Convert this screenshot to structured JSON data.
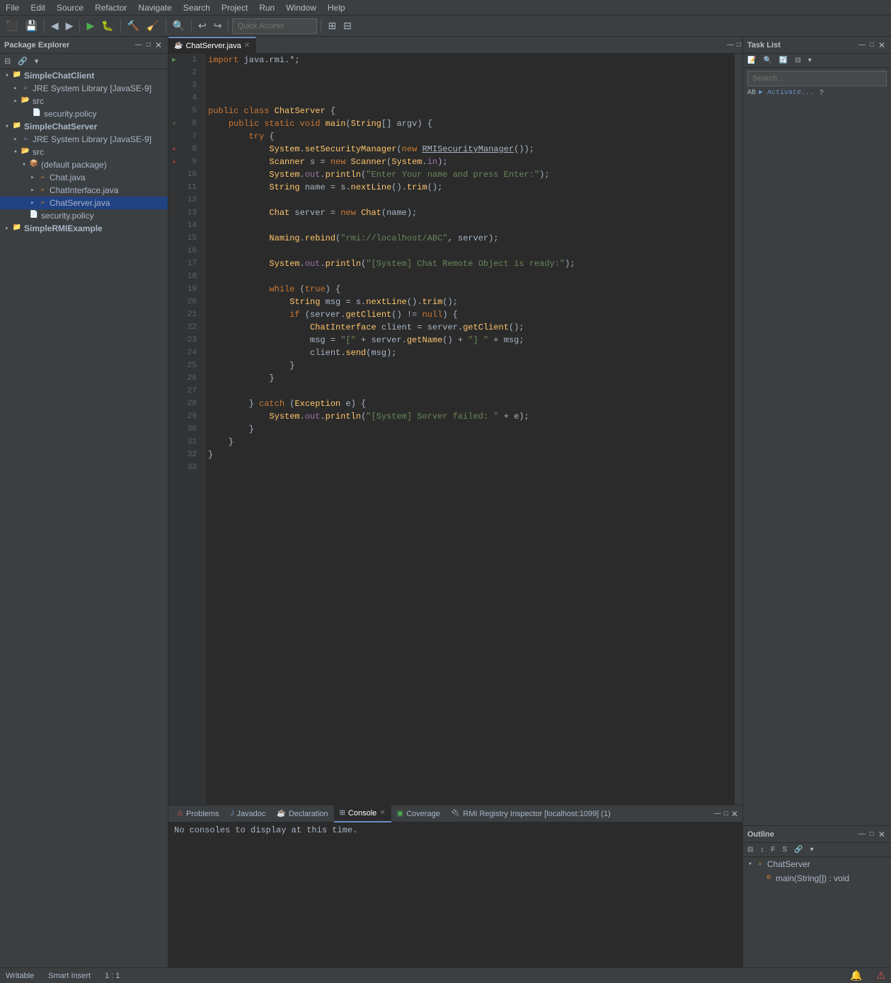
{
  "menubar": {
    "items": [
      "File",
      "Edit",
      "Source",
      "Refactor",
      "Navigate",
      "Search",
      "Project",
      "Run",
      "Window",
      "Help"
    ]
  },
  "toolbar": {
    "search_placeholder": "Quick Access",
    "buttons": [
      "⬛",
      "💾",
      "📋",
      "↩",
      "↪",
      "▶",
      "⬛",
      "🔧",
      "⬛",
      "⬛"
    ]
  },
  "package_explorer": {
    "title": "Package Explorer",
    "projects": [
      {
        "name": "SimpleChatClient",
        "expanded": true,
        "children": [
          {
            "type": "jre",
            "name": "JRE System Library [JavaSE-9]"
          },
          {
            "type": "folder",
            "name": "src",
            "expanded": true,
            "children": [
              {
                "type": "file",
                "name": "security.policy"
              }
            ]
          }
        ]
      },
      {
        "name": "SimpleChatServer",
        "expanded": true,
        "children": [
          {
            "type": "jre",
            "name": "JRE System Library [JavaSE-9]"
          },
          {
            "type": "folder",
            "name": "src",
            "expanded": true,
            "children": [
              {
                "type": "package",
                "name": "(default package)",
                "expanded": true,
                "children": [
                  {
                    "type": "java",
                    "name": "Chat.java"
                  },
                  {
                    "type": "java",
                    "name": "ChatInterface.java"
                  },
                  {
                    "type": "java",
                    "name": "ChatServer.java",
                    "selected": true
                  }
                ]
              },
              {
                "type": "file",
                "name": "security.policy"
              }
            ]
          }
        ]
      },
      {
        "name": "SimpleRMIExample",
        "expanded": false,
        "children": []
      }
    ]
  },
  "editor": {
    "tab_title": "ChatServer.java",
    "lines": [
      {
        "num": 1,
        "code": "import java.rmi.*;"
      },
      {
        "num": 2,
        "code": ""
      },
      {
        "num": 3,
        "code": ""
      },
      {
        "num": 4,
        "code": ""
      },
      {
        "num": 5,
        "code": "public class ChatServer {"
      },
      {
        "num": 6,
        "code": "    public static void main(String[] argv) {"
      },
      {
        "num": 7,
        "code": "        try {"
      },
      {
        "num": 8,
        "code": "            System.setSecurityManager(new RMISecurityManager());"
      },
      {
        "num": 9,
        "code": "            Scanner s = new Scanner(System.in);"
      },
      {
        "num": 10,
        "code": "            System.out.println(\"Enter Your name and press Enter:\");"
      },
      {
        "num": 11,
        "code": "            String name = s.nextLine().trim();"
      },
      {
        "num": 12,
        "code": ""
      },
      {
        "num": 13,
        "code": "            Chat server = new Chat(name);"
      },
      {
        "num": 14,
        "code": ""
      },
      {
        "num": 15,
        "code": "            Naming.rebind(\"rmi://localhost/ABC\", server);"
      },
      {
        "num": 16,
        "code": ""
      },
      {
        "num": 17,
        "code": "            System.out.println(\"[System] Chat Remote Object is ready:\");"
      },
      {
        "num": 18,
        "code": ""
      },
      {
        "num": 19,
        "code": "            while (true) {"
      },
      {
        "num": 20,
        "code": "                String msg = s.nextLine().trim();"
      },
      {
        "num": 21,
        "code": "                if (server.getClient() != null) {"
      },
      {
        "num": 22,
        "code": "                    ChatInterface client = server.getClient();"
      },
      {
        "num": 23,
        "code": "                    msg = \"[\" + server.getName() + \"] \" + msg;"
      },
      {
        "num": 24,
        "code": "                    client.send(msg);"
      },
      {
        "num": 25,
        "code": "                }"
      },
      {
        "num": 26,
        "code": "            }"
      },
      {
        "num": 27,
        "code": ""
      },
      {
        "num": 28,
        "code": "        } catch (Exception e) {"
      },
      {
        "num": 29,
        "code": "            System.out.println(\"[System] Server failed: \" + e);"
      },
      {
        "num": 30,
        "code": "        }"
      },
      {
        "num": 31,
        "code": "    }"
      },
      {
        "num": 32,
        "code": "}"
      },
      {
        "num": 33,
        "code": ""
      }
    ]
  },
  "task_list": {
    "title": "Task List"
  },
  "outline": {
    "title": "Outline",
    "items": [
      {
        "name": "ChatServer",
        "type": "class"
      },
      {
        "name": "main(String[]) : void",
        "type": "method"
      }
    ]
  },
  "bottom_tabs": [
    {
      "label": "Problems",
      "active": false
    },
    {
      "label": "Javadoc",
      "active": false
    },
    {
      "label": "Declaration",
      "active": false
    },
    {
      "label": "Console",
      "active": true
    },
    {
      "label": "Coverage",
      "active": false
    },
    {
      "label": "RMI Registry Inspector [localhost:1099] (1)",
      "active": false
    }
  ],
  "console": {
    "message": "No consoles to display at this time."
  },
  "status_bar": {
    "writable": "Writable",
    "insert_mode": "Smart Insert",
    "position": "1 : 1"
  }
}
